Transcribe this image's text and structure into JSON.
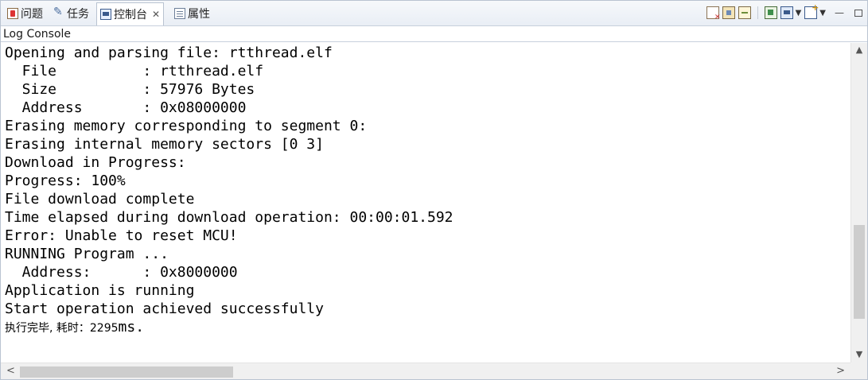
{
  "tabs": [
    {
      "label": "问题",
      "icon": "problems-icon"
    },
    {
      "label": "任务",
      "icon": "tasks-icon"
    },
    {
      "label": "控制台",
      "icon": "console-icon",
      "active": true,
      "close": "✕"
    },
    {
      "label": "属性",
      "icon": "properties-icon"
    }
  ],
  "toolbar": {
    "icons": [
      "clear-console-icon",
      "scroll-lock-icon",
      "pin-console-icon",
      "open-console-icon",
      "display-console-icon",
      "new-console-icon"
    ],
    "dropdown": "▼",
    "minimize": "—"
  },
  "console": {
    "name": "Log Console",
    "lines": [
      "Opening and parsing file: rtthread.elf",
      "  File          : rtthread.elf",
      "  Size          : 57976 Bytes",
      "  Address       : 0x08000000",
      "Erasing memory corresponding to segment 0:",
      "Erasing internal memory sectors [0 3]",
      "Download in Progress:",
      "Progress: 100%",
      "File download complete",
      "Time elapsed during download operation: 00:00:01.592",
      "Error: Unable to reset MCU!",
      "RUNNING Program ...",
      "  Address:      : 0x8000000",
      "Application is running",
      "Start operation achieved successfully"
    ],
    "last_line_cn": "执行完毕, 耗时：2295",
    "last_line_unit": "ms."
  },
  "scrollbars": {
    "up": "▲",
    "down": "▼",
    "left": "<",
    "right": ">",
    "vertical_position": 0.85,
    "horizontal_position": 0.0
  }
}
